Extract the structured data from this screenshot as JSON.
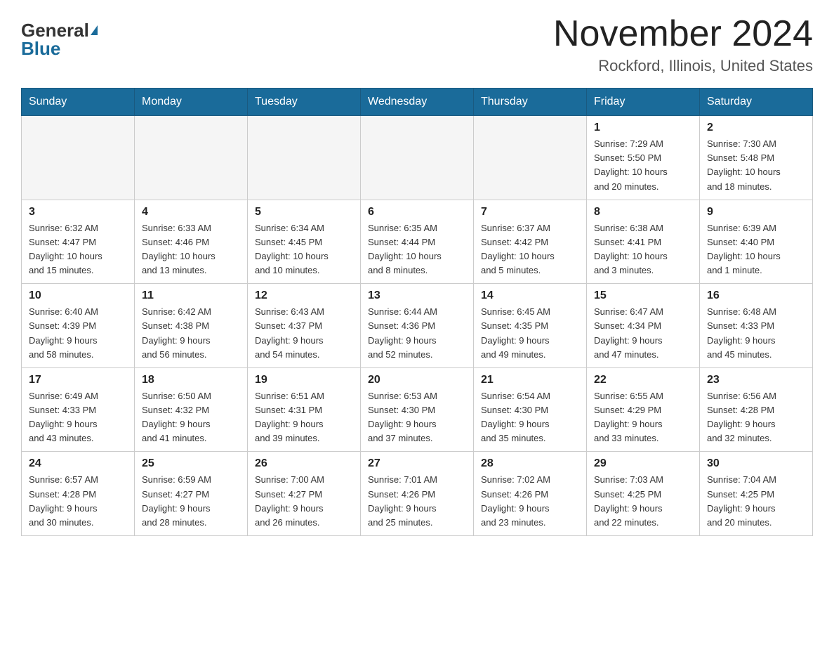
{
  "logo": {
    "general": "General",
    "blue": "Blue"
  },
  "title": "November 2024",
  "subtitle": "Rockford, Illinois, United States",
  "days_of_week": [
    "Sunday",
    "Monday",
    "Tuesday",
    "Wednesday",
    "Thursday",
    "Friday",
    "Saturday"
  ],
  "weeks": [
    [
      {
        "day": "",
        "info": ""
      },
      {
        "day": "",
        "info": ""
      },
      {
        "day": "",
        "info": ""
      },
      {
        "day": "",
        "info": ""
      },
      {
        "day": "",
        "info": ""
      },
      {
        "day": "1",
        "info": "Sunrise: 7:29 AM\nSunset: 5:50 PM\nDaylight: 10 hours\nand 20 minutes."
      },
      {
        "day": "2",
        "info": "Sunrise: 7:30 AM\nSunset: 5:48 PM\nDaylight: 10 hours\nand 18 minutes."
      }
    ],
    [
      {
        "day": "3",
        "info": "Sunrise: 6:32 AM\nSunset: 4:47 PM\nDaylight: 10 hours\nand 15 minutes."
      },
      {
        "day": "4",
        "info": "Sunrise: 6:33 AM\nSunset: 4:46 PM\nDaylight: 10 hours\nand 13 minutes."
      },
      {
        "day": "5",
        "info": "Sunrise: 6:34 AM\nSunset: 4:45 PM\nDaylight: 10 hours\nand 10 minutes."
      },
      {
        "day": "6",
        "info": "Sunrise: 6:35 AM\nSunset: 4:44 PM\nDaylight: 10 hours\nand 8 minutes."
      },
      {
        "day": "7",
        "info": "Sunrise: 6:37 AM\nSunset: 4:42 PM\nDaylight: 10 hours\nand 5 minutes."
      },
      {
        "day": "8",
        "info": "Sunrise: 6:38 AM\nSunset: 4:41 PM\nDaylight: 10 hours\nand 3 minutes."
      },
      {
        "day": "9",
        "info": "Sunrise: 6:39 AM\nSunset: 4:40 PM\nDaylight: 10 hours\nand 1 minute."
      }
    ],
    [
      {
        "day": "10",
        "info": "Sunrise: 6:40 AM\nSunset: 4:39 PM\nDaylight: 9 hours\nand 58 minutes."
      },
      {
        "day": "11",
        "info": "Sunrise: 6:42 AM\nSunset: 4:38 PM\nDaylight: 9 hours\nand 56 minutes."
      },
      {
        "day": "12",
        "info": "Sunrise: 6:43 AM\nSunset: 4:37 PM\nDaylight: 9 hours\nand 54 minutes."
      },
      {
        "day": "13",
        "info": "Sunrise: 6:44 AM\nSunset: 4:36 PM\nDaylight: 9 hours\nand 52 minutes."
      },
      {
        "day": "14",
        "info": "Sunrise: 6:45 AM\nSunset: 4:35 PM\nDaylight: 9 hours\nand 49 minutes."
      },
      {
        "day": "15",
        "info": "Sunrise: 6:47 AM\nSunset: 4:34 PM\nDaylight: 9 hours\nand 47 minutes."
      },
      {
        "day": "16",
        "info": "Sunrise: 6:48 AM\nSunset: 4:33 PM\nDaylight: 9 hours\nand 45 minutes."
      }
    ],
    [
      {
        "day": "17",
        "info": "Sunrise: 6:49 AM\nSunset: 4:33 PM\nDaylight: 9 hours\nand 43 minutes."
      },
      {
        "day": "18",
        "info": "Sunrise: 6:50 AM\nSunset: 4:32 PM\nDaylight: 9 hours\nand 41 minutes."
      },
      {
        "day": "19",
        "info": "Sunrise: 6:51 AM\nSunset: 4:31 PM\nDaylight: 9 hours\nand 39 minutes."
      },
      {
        "day": "20",
        "info": "Sunrise: 6:53 AM\nSunset: 4:30 PM\nDaylight: 9 hours\nand 37 minutes."
      },
      {
        "day": "21",
        "info": "Sunrise: 6:54 AM\nSunset: 4:30 PM\nDaylight: 9 hours\nand 35 minutes."
      },
      {
        "day": "22",
        "info": "Sunrise: 6:55 AM\nSunset: 4:29 PM\nDaylight: 9 hours\nand 33 minutes."
      },
      {
        "day": "23",
        "info": "Sunrise: 6:56 AM\nSunset: 4:28 PM\nDaylight: 9 hours\nand 32 minutes."
      }
    ],
    [
      {
        "day": "24",
        "info": "Sunrise: 6:57 AM\nSunset: 4:28 PM\nDaylight: 9 hours\nand 30 minutes."
      },
      {
        "day": "25",
        "info": "Sunrise: 6:59 AM\nSunset: 4:27 PM\nDaylight: 9 hours\nand 28 minutes."
      },
      {
        "day": "26",
        "info": "Sunrise: 7:00 AM\nSunset: 4:27 PM\nDaylight: 9 hours\nand 26 minutes."
      },
      {
        "day": "27",
        "info": "Sunrise: 7:01 AM\nSunset: 4:26 PM\nDaylight: 9 hours\nand 25 minutes."
      },
      {
        "day": "28",
        "info": "Sunrise: 7:02 AM\nSunset: 4:26 PM\nDaylight: 9 hours\nand 23 minutes."
      },
      {
        "day": "29",
        "info": "Sunrise: 7:03 AM\nSunset: 4:25 PM\nDaylight: 9 hours\nand 22 minutes."
      },
      {
        "day": "30",
        "info": "Sunrise: 7:04 AM\nSunset: 4:25 PM\nDaylight: 9 hours\nand 20 minutes."
      }
    ]
  ]
}
